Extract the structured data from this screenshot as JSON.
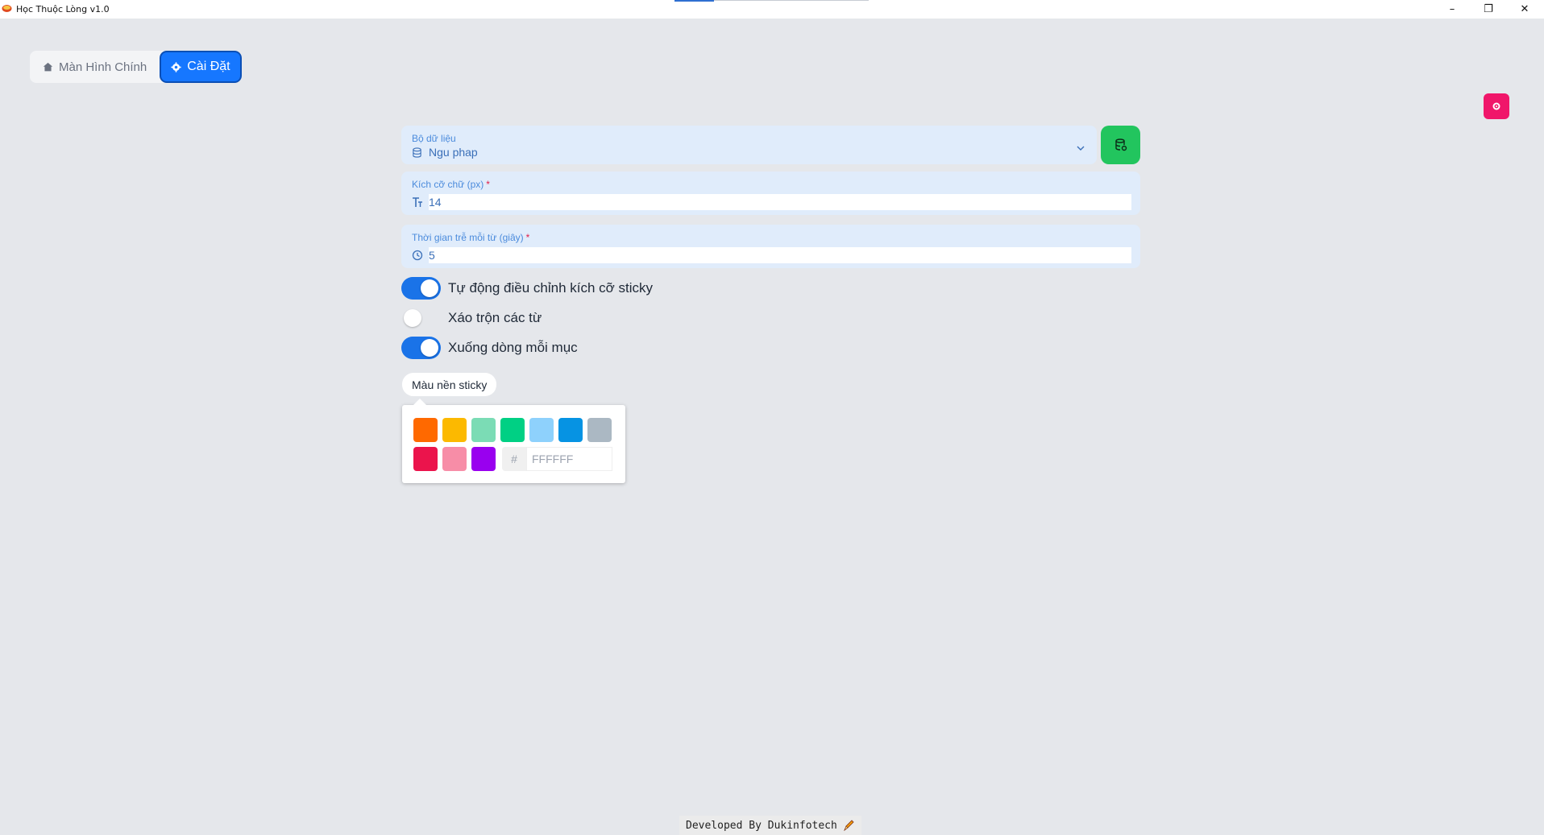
{
  "window": {
    "title": "Học Thuộc Lòng v1.0",
    "minimize_glyph": "–",
    "restore_glyph": "❐",
    "close_glyph": "✕"
  },
  "tabs": [
    {
      "label": "Màn Hình Chính",
      "icon": "home-icon",
      "active": false
    },
    {
      "label": "Cài Đặt",
      "icon": "gear-icon",
      "active": true
    }
  ],
  "form": {
    "dataset": {
      "label": "Bộ dữ liệu",
      "value": "Ngu phap",
      "icon": "database-icon"
    },
    "font_size": {
      "label": "Kích cỡ chữ (px)",
      "required_mark": "*",
      "value": "14",
      "icon": "text-size-icon"
    },
    "delay": {
      "label": "Thời gian trễ mỗi từ (giây)",
      "required_mark": "*",
      "value": "5",
      "icon": "clock-icon"
    }
  },
  "toggles": [
    {
      "label": "Tự động điều chỉnh kích cỡ sticky",
      "on": true
    },
    {
      "label": "Xáo trộn các từ",
      "on": false
    },
    {
      "label": "Xuống dòng mỗi mục",
      "on": true
    }
  ],
  "color_picker": {
    "label": "Màu nền sticky",
    "swatches": [
      "#ff6900",
      "#fcb900",
      "#7bdcb5",
      "#00d084",
      "#8ed1fc",
      "#0693e3",
      "#abb8c3",
      "#eb144c",
      "#f78da7",
      "#9900ef"
    ],
    "hash_symbol": "#",
    "hex_placeholder": "FFFFFF"
  },
  "colors": {
    "primary": "#1677ff",
    "success": "#22c55e",
    "danger": "#f0166a"
  },
  "footer": {
    "text": "Developed By Dukinfotech",
    "icon": "pencil-icon"
  }
}
